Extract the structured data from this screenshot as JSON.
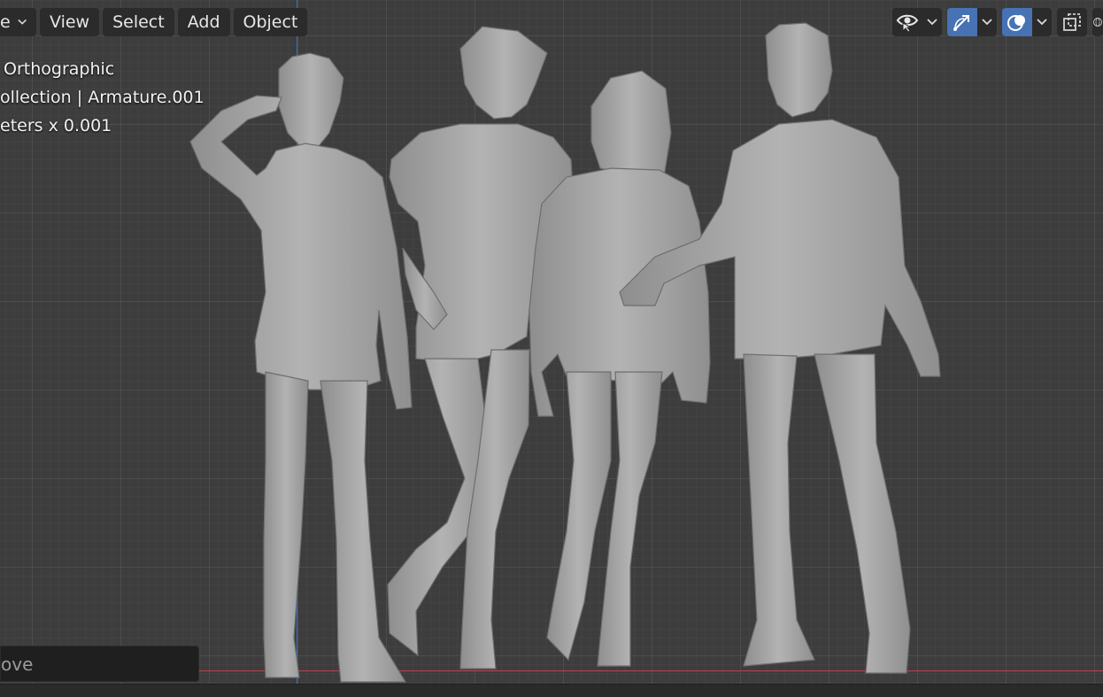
{
  "header": {
    "editor_menu_label": "e",
    "menus": [
      "View",
      "Select",
      "Add",
      "Object"
    ]
  },
  "viewport_overlay": {
    "view_name": "Orthographic",
    "collection_info": "ollection | Armature.001",
    "units_info": "eters x 0.001"
  },
  "toolbar_right": {
    "visibility_icon": "eye-pointer-icon",
    "gizmo_icon": "gizmo-arrow-icon",
    "overlay_icon": "overlays-icon",
    "xray_icon": "xray-toggle-icon",
    "shading_icon": "wireframe-shading-icon"
  },
  "operator_panel": {
    "label": "ove"
  },
  "colors": {
    "background": "#3d3d3d",
    "header_button": "#2b2b2b",
    "active_blue": "#4772b3",
    "axis_x": "#b9454f",
    "axis_y": "#3b6fb5",
    "model_gray": "#a9a9a9"
  }
}
